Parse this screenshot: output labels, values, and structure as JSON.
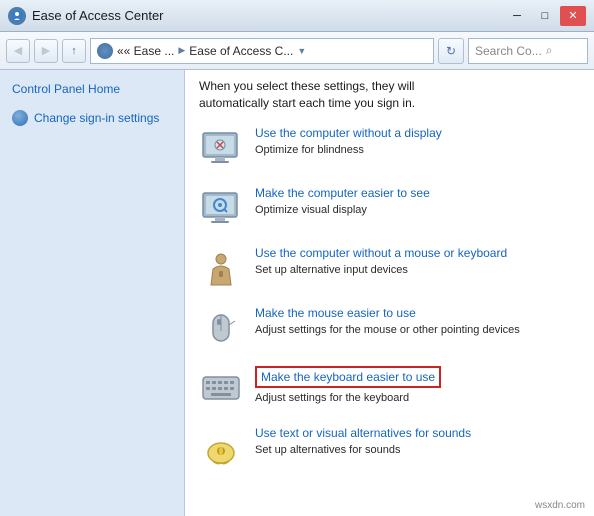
{
  "titleBar": {
    "icon": "●",
    "title": "Ease of Access Center",
    "minimize": "─",
    "maximize": "□",
    "close": "✕"
  },
  "addressBar": {
    "back": "◀",
    "forward": "▶",
    "up": "↑",
    "breadcrumb1": "«« Ease ...",
    "arrow": "▶",
    "breadcrumb2": "Ease of Access C...",
    "dropdownArrow": "▼",
    "refresh": "↻",
    "searchPlaceholder": "Search Co...",
    "searchIcon": "⌕"
  },
  "sidebar": {
    "controlPanelHome": "Control Panel Home",
    "changeSignIn": "Change sign-in settings"
  },
  "content": {
    "introLine1": "When you select these settings, they will",
    "introLine2": "automatically start each time you sign in.",
    "items": [
      {
        "id": "no-display",
        "link": "Use the computer without a display",
        "desc": "Optimize for blindness",
        "iconType": "monitor"
      },
      {
        "id": "easier-see",
        "link": "Make the computer easier to see",
        "desc": "Optimize visual display",
        "iconType": "monitor2"
      },
      {
        "id": "no-mouse",
        "link": "Use the computer without a mouse or keyboard",
        "desc": "Set up alternative input devices",
        "iconType": "user"
      },
      {
        "id": "mouse",
        "link": "Make the mouse easier to use",
        "desc": "Adjust settings for the mouse or other pointing devices",
        "iconType": "mouse"
      },
      {
        "id": "keyboard",
        "link": "Make the keyboard easier to use",
        "desc": "Adjust settings for the keyboard",
        "iconType": "keyboard",
        "highlighted": true
      },
      {
        "id": "sounds",
        "link": "Use text or visual alternatives for sounds",
        "desc": "Set up alternatives for sounds",
        "iconType": "speech"
      }
    ]
  },
  "watermark": "wsxdn.com"
}
